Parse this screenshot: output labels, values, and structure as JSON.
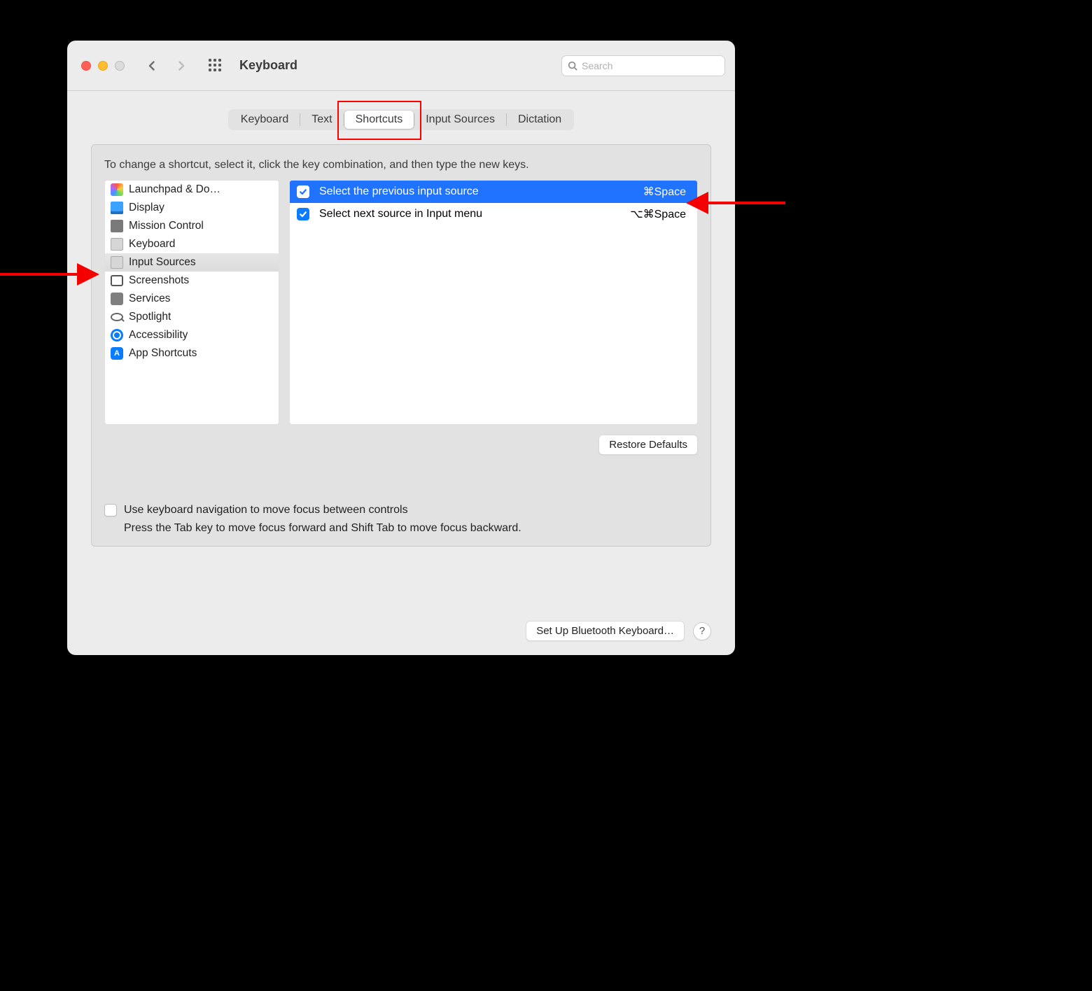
{
  "titlebar": {
    "title": "Keyboard",
    "search_placeholder": "Search"
  },
  "tabs": [
    {
      "label": "Keyboard",
      "active": false
    },
    {
      "label": "Text",
      "active": false
    },
    {
      "label": "Shortcuts",
      "active": true
    },
    {
      "label": "Input Sources",
      "active": false
    },
    {
      "label": "Dictation",
      "active": false
    }
  ],
  "hint": "To change a shortcut, select it, click the key combination, and then type the new keys.",
  "categories": [
    {
      "label": "Launchpad & Do…",
      "icon": "launchpad",
      "selected": false
    },
    {
      "label": "Display",
      "icon": "display",
      "selected": false
    },
    {
      "label": "Mission Control",
      "icon": "mission",
      "selected": false
    },
    {
      "label": "Keyboard",
      "icon": "keyboard",
      "selected": false
    },
    {
      "label": "Input Sources",
      "icon": "input",
      "selected": true
    },
    {
      "label": "Screenshots",
      "icon": "screenshot",
      "selected": false
    },
    {
      "label": "Services",
      "icon": "services",
      "selected": false
    },
    {
      "label": "Spotlight",
      "icon": "spotlight",
      "selected": false
    },
    {
      "label": "Accessibility",
      "icon": "access",
      "selected": false
    },
    {
      "label": "App Shortcuts",
      "icon": "appshort",
      "selected": false
    }
  ],
  "shortcuts": [
    {
      "checked": true,
      "label": "Select the previous input source",
      "keys": "⌘Space",
      "selected": true
    },
    {
      "checked": true,
      "label": "Select next source in Input menu",
      "keys": "⌥⌘Space",
      "selected": false
    }
  ],
  "buttons": {
    "restore": "Restore Defaults",
    "bluetooth": "Set Up Bluetooth Keyboard…"
  },
  "kbnav": {
    "checkbox_label": "Use keyboard navigation to move focus between controls",
    "subtext": "Press the Tab key to move focus forward and Shift Tab to move focus backward."
  },
  "annotations": {
    "highlight_tab_index": 2
  }
}
